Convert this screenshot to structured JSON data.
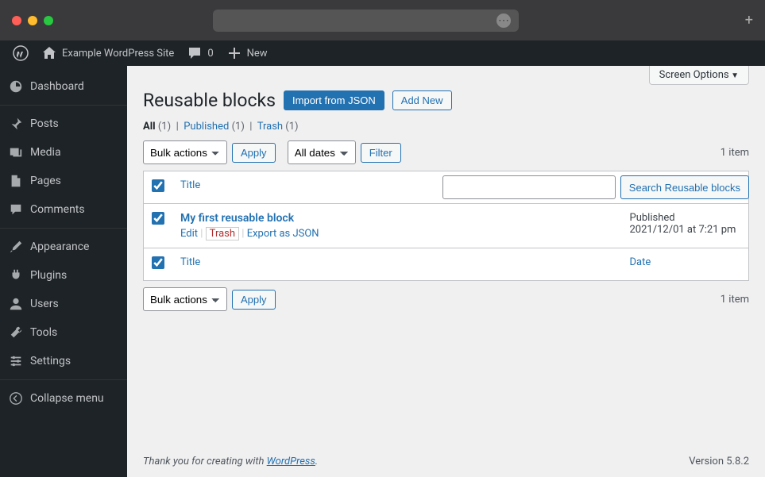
{
  "adminbar": {
    "site_name": "Example WordPress Site",
    "comments_count": "0",
    "new_label": "New"
  },
  "sidebar": {
    "dashboard": "Dashboard",
    "posts": "Posts",
    "media": "Media",
    "pages": "Pages",
    "comments": "Comments",
    "appearance": "Appearance",
    "plugins": "Plugins",
    "users": "Users",
    "tools": "Tools",
    "settings": "Settings",
    "collapse": "Collapse menu"
  },
  "screen_options_label": "Screen Options",
  "page_title": "Reusable blocks",
  "buttons": {
    "import_json": "Import from JSON",
    "add_new": "Add New",
    "apply": "Apply",
    "filter": "Filter",
    "search": "Search Reusable blocks"
  },
  "subsubsub": {
    "all_label": "All",
    "all_count": "(1)",
    "published_label": "Published",
    "published_count": "(1)",
    "trash_label": "Trash",
    "trash_count": "(1)"
  },
  "selects": {
    "bulk_actions": "Bulk actions",
    "all_dates": "All dates"
  },
  "item_count": "1 item",
  "columns": {
    "title": "Title",
    "date": "Date"
  },
  "rows": [
    {
      "title": "My first reusable block",
      "edit": "Edit",
      "trash": "Trash",
      "export": "Export as JSON",
      "status": "Published",
      "date": "2021/12/01 at 7:21 pm"
    }
  ],
  "footer": {
    "thanks_prefix": "Thank you for creating with ",
    "wp_link": "WordPress",
    "period": ".",
    "version": "Version 5.8.2"
  }
}
